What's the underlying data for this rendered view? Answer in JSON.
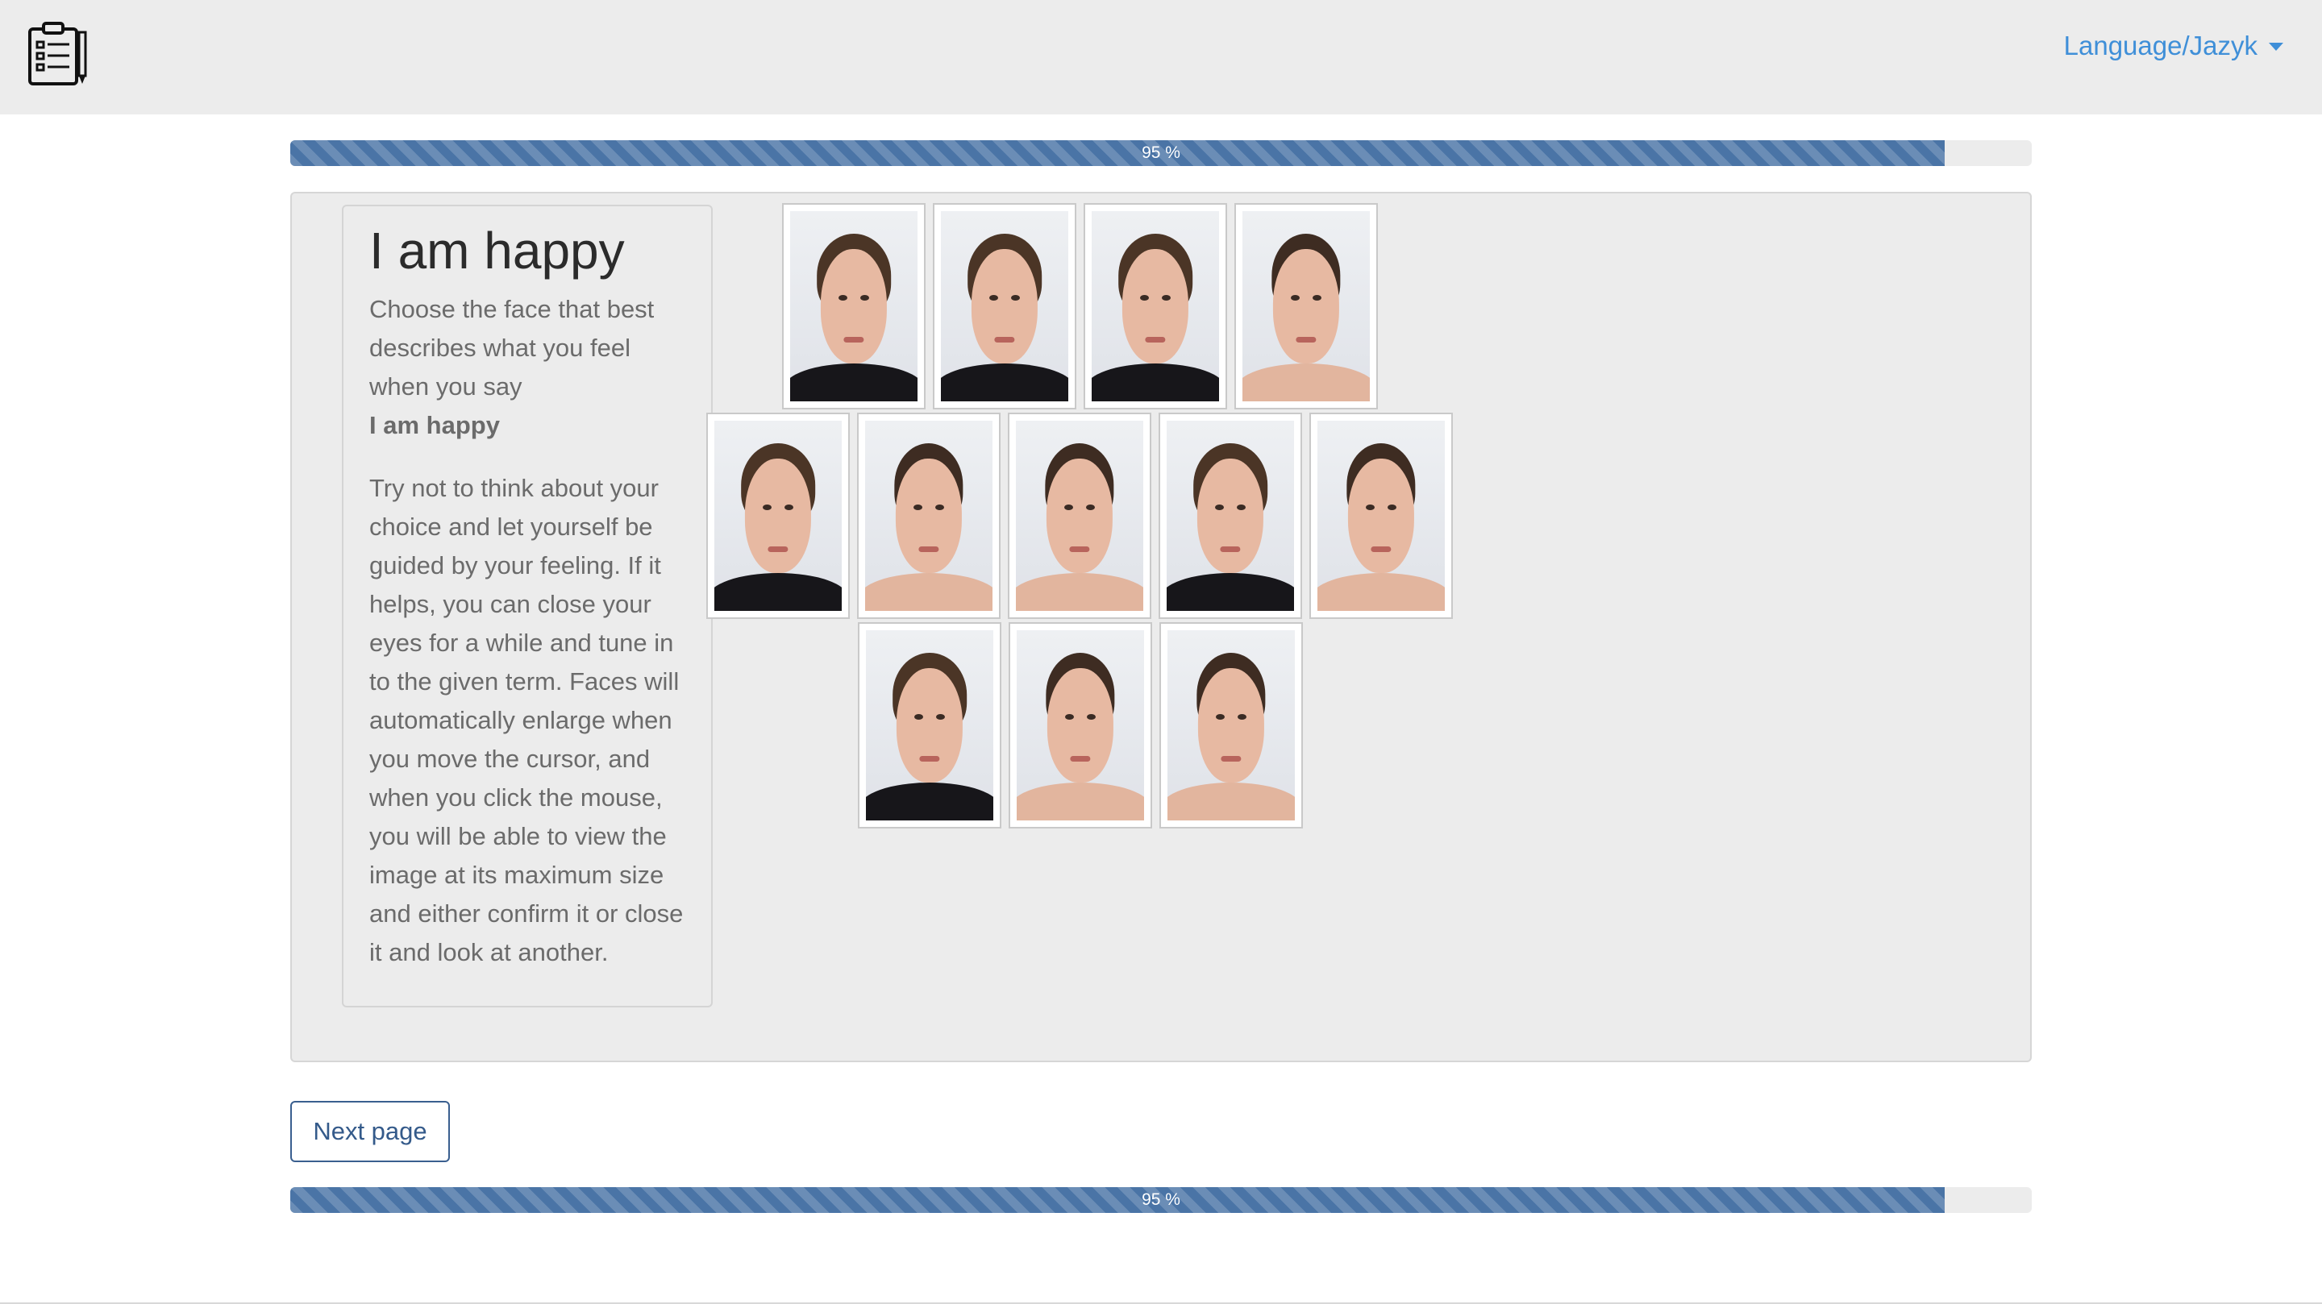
{
  "header": {
    "logo_icon": "clipboard-checklist-icon",
    "language_label": "Language/Jazyk"
  },
  "progress": {
    "value_percent": 95,
    "label": "95 %"
  },
  "intro": {
    "title": "I am happy",
    "instruction": "Choose the face that best describes what you feel when you say",
    "term": "I am happy",
    "help_text": "Try not to think about your choice and let yourself be guided by your feeling. If it helps, you can close your eyes for a while and tune in to the given term. Faces will automatically enlarge when you move the cursor, and when you click the mouse, you will be able to view the image at its maximum size and either confirm it or close it and look at another."
  },
  "faces": [
    {
      "row": 1,
      "gender": "male"
    },
    {
      "row": 1,
      "gender": "male"
    },
    {
      "row": 1,
      "gender": "male"
    },
    {
      "row": 1,
      "gender": "female"
    },
    {
      "row": 2,
      "gender": "male"
    },
    {
      "row": 2,
      "gender": "female"
    },
    {
      "row": 2,
      "gender": "female"
    },
    {
      "row": 2,
      "gender": "male"
    },
    {
      "row": 2,
      "gender": "female"
    },
    {
      "row": 3,
      "gender": "male"
    },
    {
      "row": 3,
      "gender": "female"
    },
    {
      "row": 3,
      "gender": "female"
    }
  ],
  "buttons": {
    "next_label": "Next page"
  },
  "colors": {
    "accent_link": "#3f8fd8",
    "progress_fill": "#4a74a6",
    "button_text": "#345a8a"
  }
}
